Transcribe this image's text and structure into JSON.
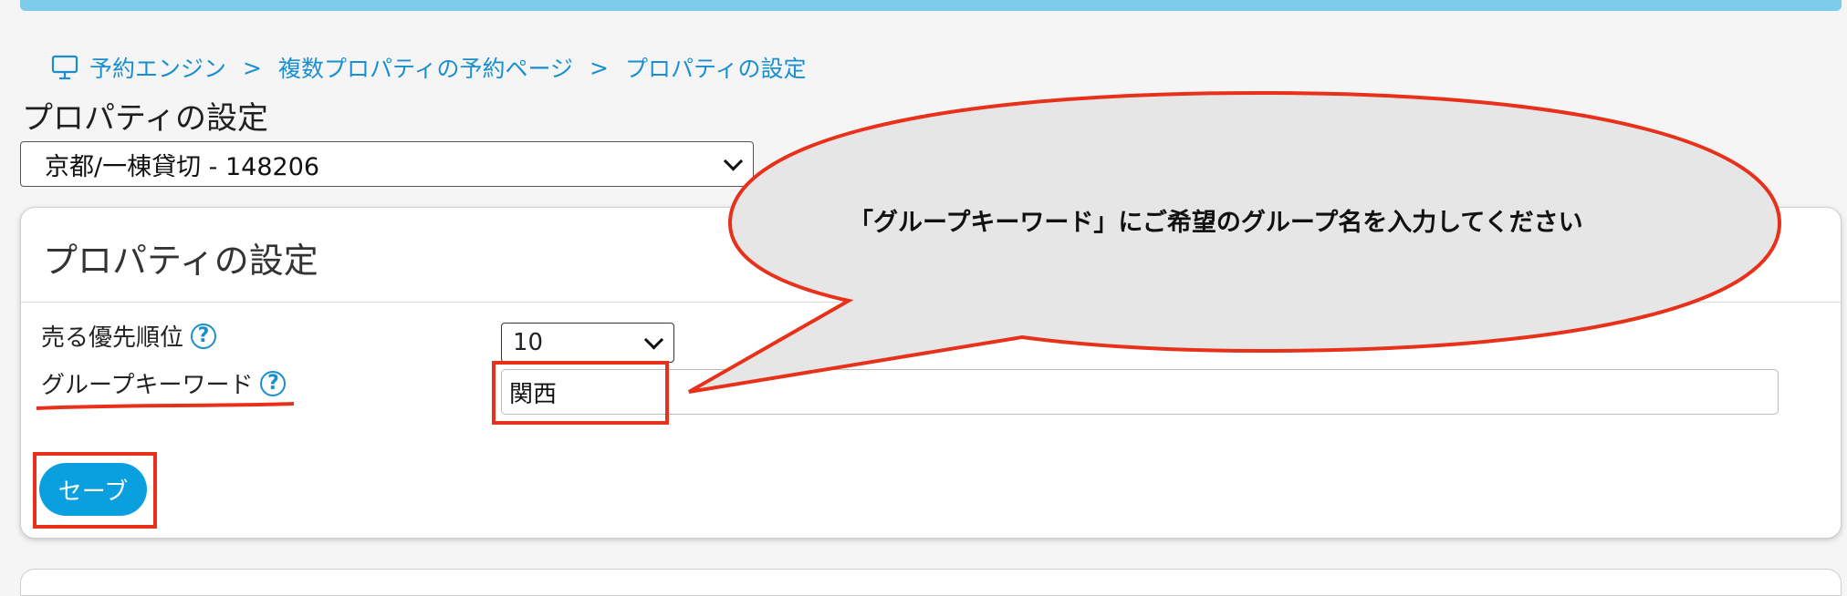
{
  "breadcrumb": {
    "items": [
      "予約エンジン",
      "複数プロパティの予約ページ",
      "プロパティの設定"
    ],
    "separator": ">"
  },
  "page_title": "プロパティの設定",
  "property_select": {
    "value": "京都/一棟貸切 - 148206"
  },
  "card": {
    "title": "プロパティの設定",
    "fields": {
      "priority": {
        "label": "売る優先順位",
        "value": "10"
      },
      "keyword": {
        "label": "グループキーワード",
        "value": "関西"
      }
    },
    "save_label": "セーブ"
  },
  "annotation": {
    "callout_text": "「グループキーワード」にご希望のグループ名を入力してください"
  },
  "colors": {
    "accent": "#0aa0e0",
    "link": "#1a8fd0",
    "topbar": "#7ccbea",
    "annotation_stroke": "#e8311a",
    "bubble_fill": "#e6e6e6"
  },
  "icons": {
    "breadcrumb": "monitor-icon",
    "help": "help-circle-icon"
  }
}
